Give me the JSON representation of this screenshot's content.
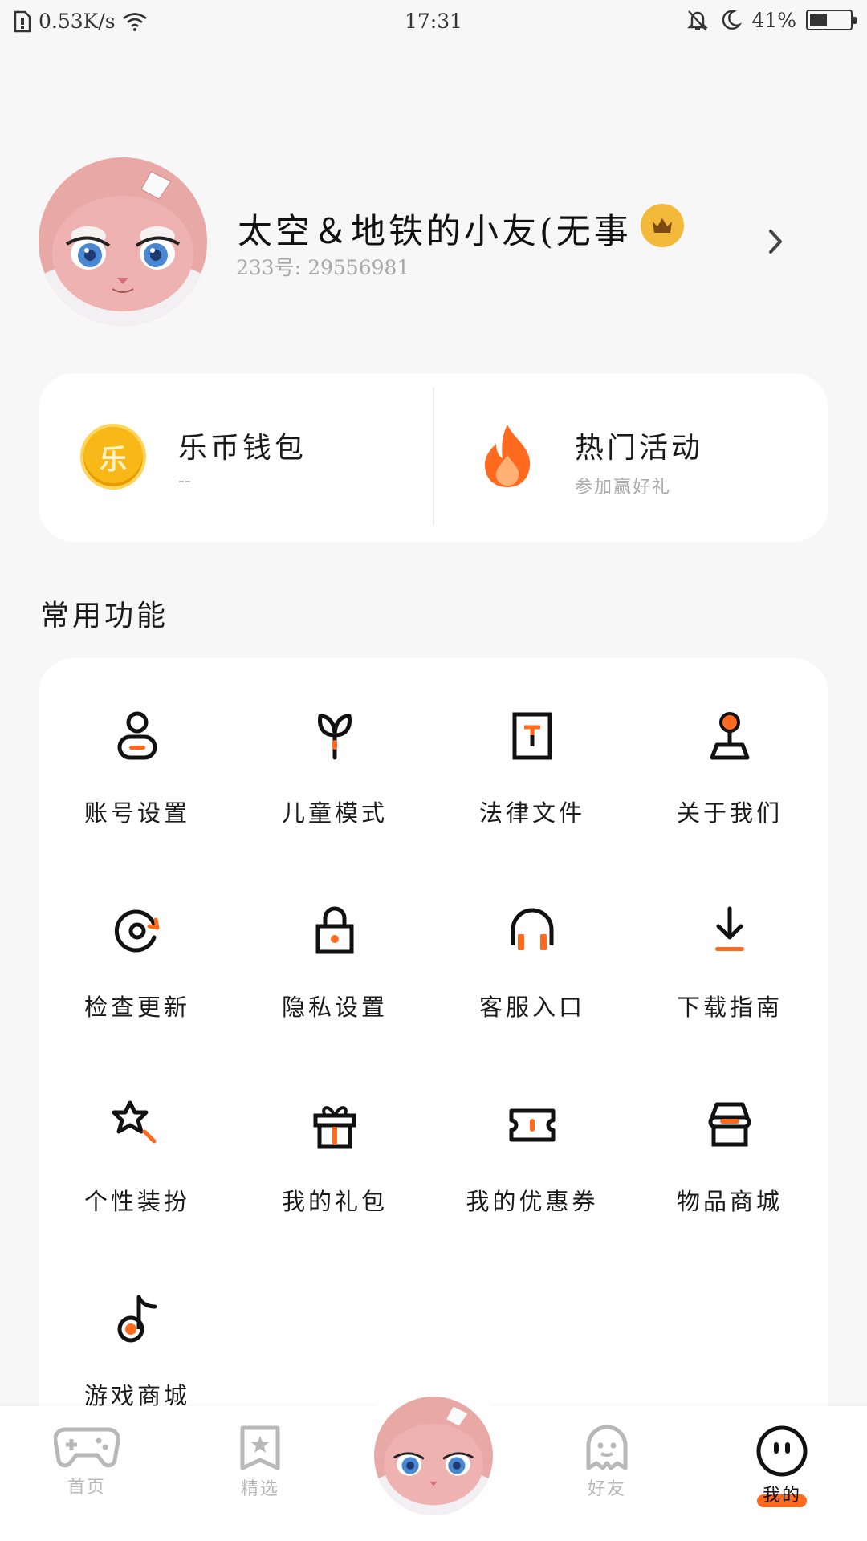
{
  "status_bar": {
    "speed": "0.53K/s",
    "time": "17:31",
    "battery": "41%",
    "battery_level": 0.41
  },
  "profile": {
    "name": "太空＆地铁的小友(无事",
    "id_text": "233号: 29556981"
  },
  "wallet_card": {
    "coin_glyph": "乐",
    "wallet_title": "乐币钱包",
    "wallet_sub": "--",
    "activity_title": "热门活动",
    "activity_sub": "参加赢好礼"
  },
  "section_title": "常用功能",
  "functions": [
    {
      "label": "账号设置",
      "icon": "user-icon"
    },
    {
      "label": "儿童模式",
      "icon": "sprout-icon"
    },
    {
      "label": "法律文件",
      "icon": "document-icon"
    },
    {
      "label": "关于我们",
      "icon": "joystick-pin-icon"
    },
    {
      "label": "检查更新",
      "icon": "refresh-icon"
    },
    {
      "label": "隐私设置",
      "icon": "lock-icon"
    },
    {
      "label": "客服入口",
      "icon": "headset-icon"
    },
    {
      "label": "下载指南",
      "icon": "download-icon"
    },
    {
      "label": "个性装扮",
      "icon": "magic-wand-icon"
    },
    {
      "label": "我的礼包",
      "icon": "gift-icon"
    },
    {
      "label": "我的优惠券",
      "icon": "ticket-icon"
    },
    {
      "label": "物品商城",
      "icon": "shop-icon"
    },
    {
      "label": "游戏商城",
      "icon": "music-note-icon"
    }
  ],
  "bottom_nav": {
    "home": "首页",
    "featured": "精选",
    "friends": "好友",
    "mine": "我的"
  },
  "colors": {
    "accent": "#ff6a1f",
    "crown": "#f2b93b",
    "coin": "#f7b818"
  }
}
